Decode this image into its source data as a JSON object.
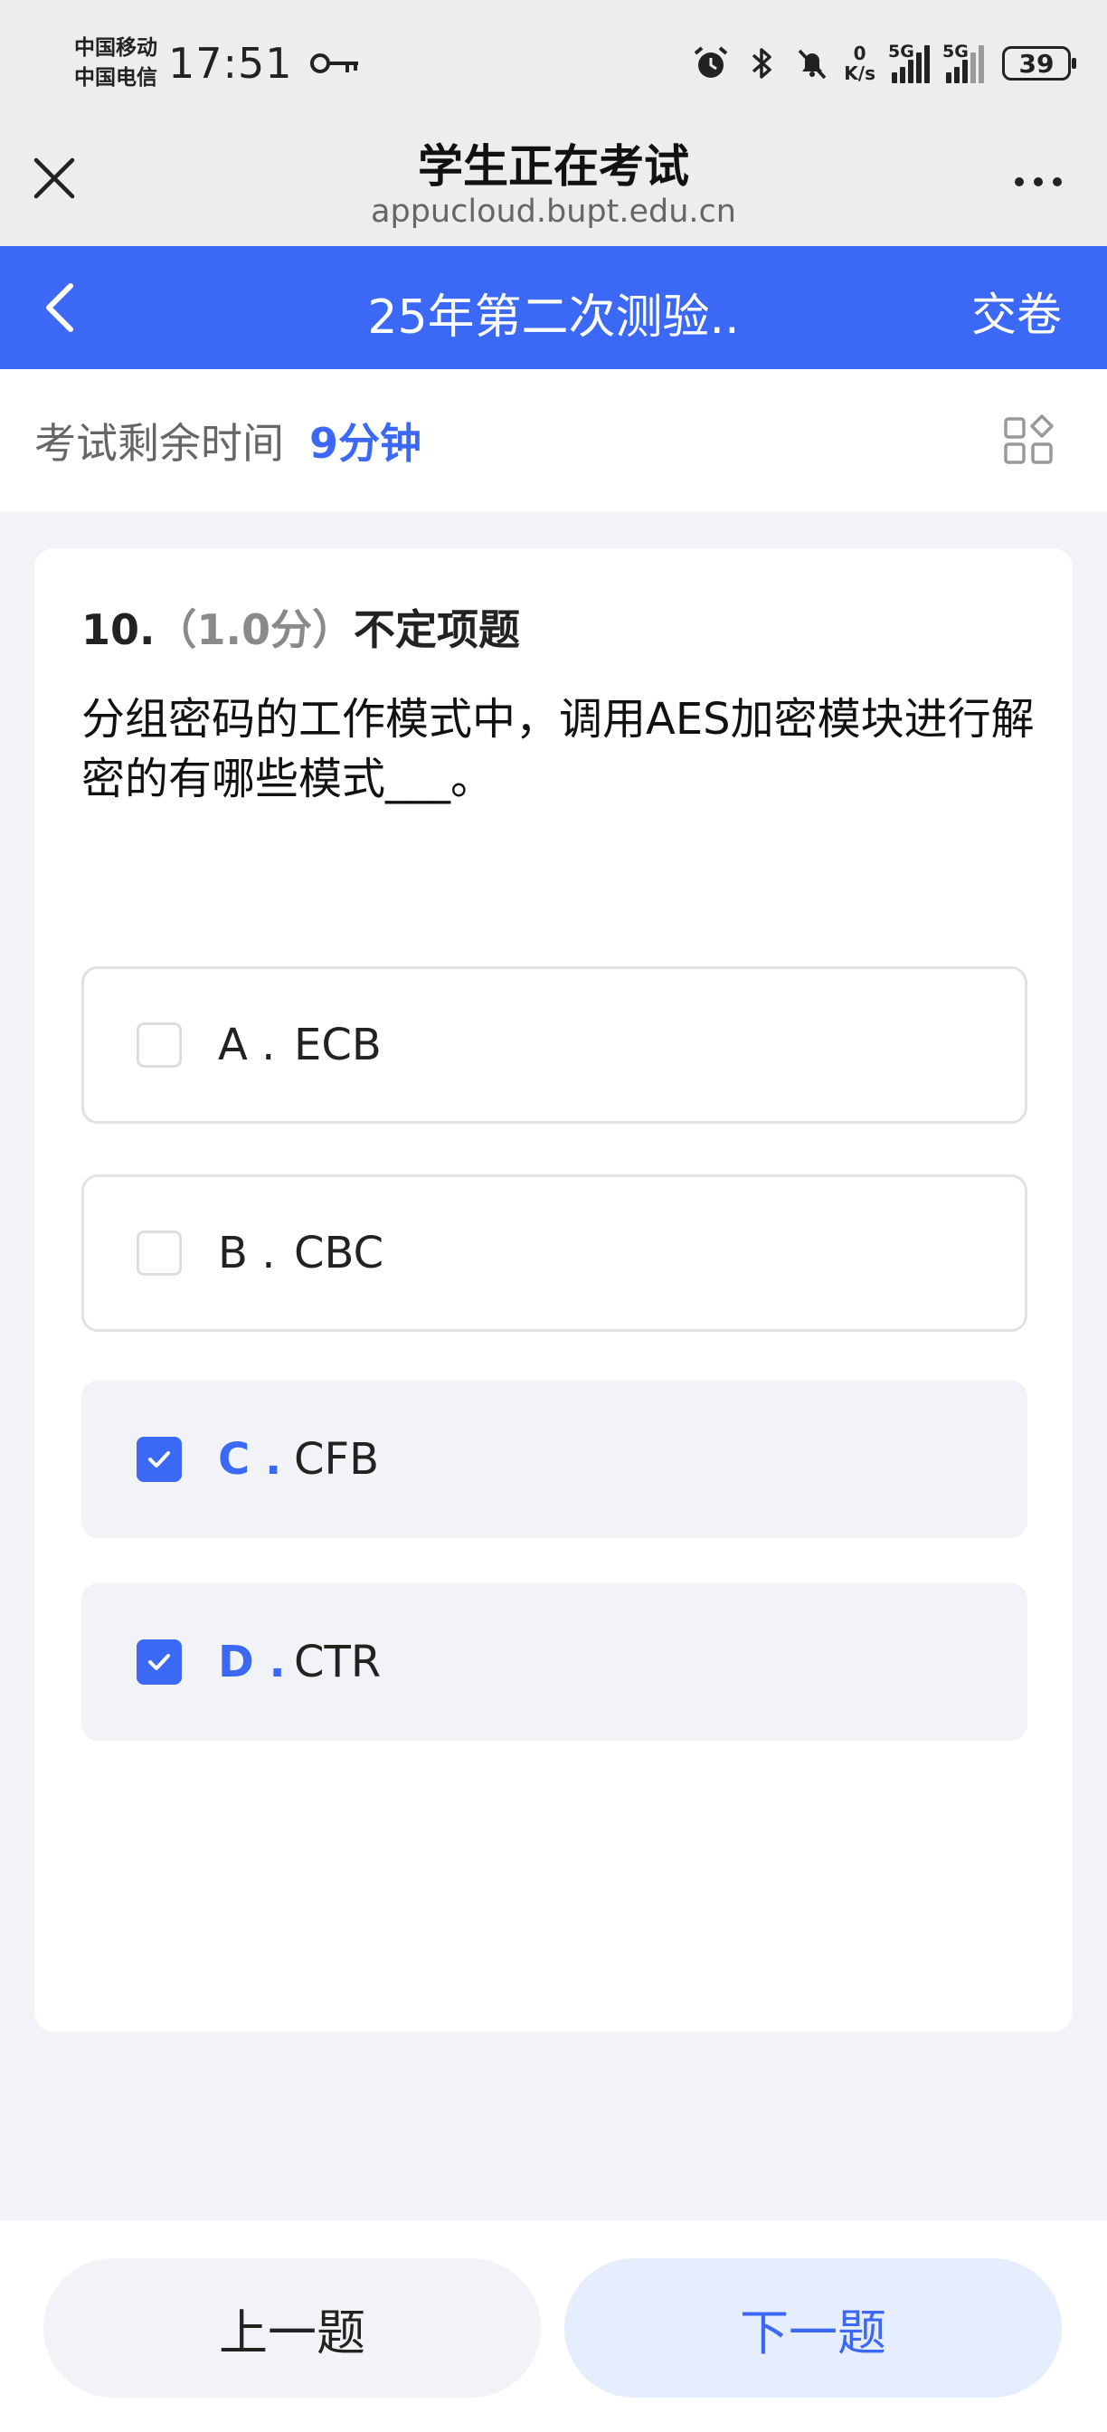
{
  "status_bar": {
    "carrier_1": "中国移动",
    "carrier_2": "中国电信",
    "time": "17:51",
    "net_speed_value": "0",
    "net_speed_unit": "K/s",
    "signal_1_tag": "5G",
    "signal_2_tag": "5G",
    "battery": "39"
  },
  "browser": {
    "title": "学生正在考试",
    "url": "appucloud.bupt.edu.cn"
  },
  "exam_header": {
    "title": "25年第二次测验..",
    "submit_label": "交卷"
  },
  "timer": {
    "label": "考试剩余时间",
    "value": "9分钟"
  },
  "question": {
    "number": "10.",
    "score": "（1.0分）",
    "type": "不定项题",
    "text": "分组密码的工作模式中，调用AES加密模块进行解密的有哪些模式___。",
    "options": [
      {
        "letter": "A .",
        "text": "ECB",
        "checked": false
      },
      {
        "letter": "B .",
        "text": "CBC",
        "checked": false
      },
      {
        "letter": "C .",
        "text": "CFB",
        "checked": true
      },
      {
        "letter": "D .",
        "text": "CTR",
        "checked": true
      }
    ]
  },
  "nav": {
    "prev_label": "上一题",
    "next_label": "下一题"
  },
  "colors": {
    "accent": "#3b69f5",
    "accent_light": "#e6edfd",
    "page_bg": "#f2f3f7"
  }
}
